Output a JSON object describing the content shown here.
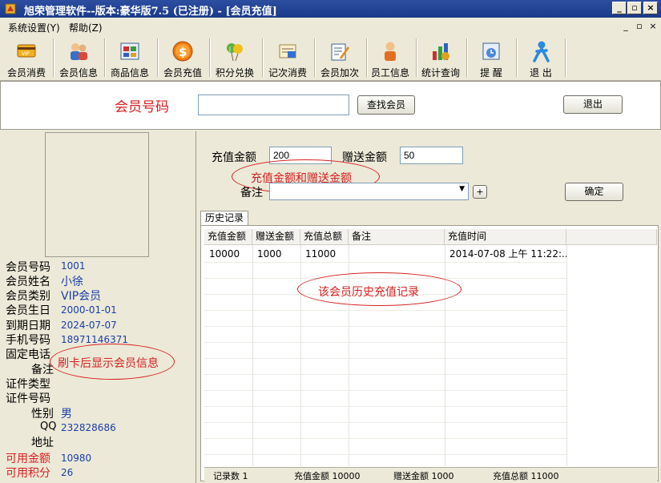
{
  "window": {
    "title": "旭荣管理软件--版本:豪华版7.5 (已注册) - [会员充值]"
  },
  "menu": {
    "items": [
      "系统设置(Y)",
      "帮助(Z)"
    ]
  },
  "toolbar": {
    "items": [
      {
        "label": "会员消费",
        "icon": "card-icon"
      },
      {
        "label": "会员信息",
        "icon": "members-icon"
      },
      {
        "label": "商品信息",
        "icon": "goods-icon"
      },
      {
        "label": "会员充值",
        "icon": "coin-icon"
      },
      {
        "label": "积分兑换",
        "icon": "balloon-icon"
      },
      {
        "label": "记次消费",
        "icon": "stamp-icon"
      },
      {
        "label": "会员加次",
        "icon": "edit-icon"
      },
      {
        "label": "员工信息",
        "icon": "staff-icon"
      },
      {
        "label": "统计查询",
        "icon": "stats-icon"
      },
      {
        "label": "提 醒",
        "icon": "reminder-icon"
      },
      {
        "label": "退 出",
        "icon": "exit-icon"
      }
    ]
  },
  "search": {
    "label": "会员号码",
    "value": "",
    "button": "查找会员",
    "exit_button": "退出"
  },
  "member": {
    "fields": [
      {
        "label": "会员号码",
        "value": "1001",
        "red": false
      },
      {
        "label": "会员姓名",
        "value": "小徐",
        "red": false
      },
      {
        "label": "会员类别",
        "value": "VIP会员",
        "red": false
      },
      {
        "label": "会员生日",
        "value": "2000-01-01",
        "red": false
      },
      {
        "label": "到期日期",
        "value": "2024-07-07",
        "red": false
      },
      {
        "label": "手机号码",
        "value": "18971146371",
        "red": false
      },
      {
        "label": "固定电话",
        "value": "",
        "red": false
      },
      {
        "label": "备注",
        "value": "",
        "red": false
      },
      {
        "label": "证件类型",
        "value": "",
        "red": false
      },
      {
        "label": "证件号码",
        "value": "",
        "red": false
      },
      {
        "label": "性别",
        "value": "男",
        "red": false
      },
      {
        "label": "QQ",
        "value": "232828686",
        "red": false
      },
      {
        "label": "地址",
        "value": "",
        "red": false
      },
      {
        "label": "可用金额",
        "value": "10980",
        "red": true
      },
      {
        "label": "可用积分",
        "value": "26",
        "red": true
      }
    ],
    "annotation": "刷卡后显示会员信息"
  },
  "recharge": {
    "amount_label": "充值金额",
    "amount_value": "200",
    "gift_label": "赠送金额",
    "gift_value": "50",
    "remark_label": "备注",
    "remark_value": "",
    "add_button": "+",
    "confirm_button": "确定",
    "annotation": "充值金额和赠送金额"
  },
  "history": {
    "tab_label": "历史记录",
    "columns": [
      "充值金额",
      "赠送金额",
      "充值总额",
      "备注",
      "充值时间"
    ],
    "rows": [
      [
        "10000",
        "1000",
        "11000",
        "",
        "2014-07-08 上午 11:22:..."
      ]
    ],
    "annotation": "该会员历史充值记录",
    "footer": {
      "count": "记录数 1",
      "amount": "充值金额 10000",
      "gift": "赠送金额 1000",
      "total": "充值总额 11000"
    }
  },
  "colors": {
    "accent_red": "#d62020",
    "value_blue": "#1a3ea8",
    "titlebar": "#1a3a8a"
  }
}
